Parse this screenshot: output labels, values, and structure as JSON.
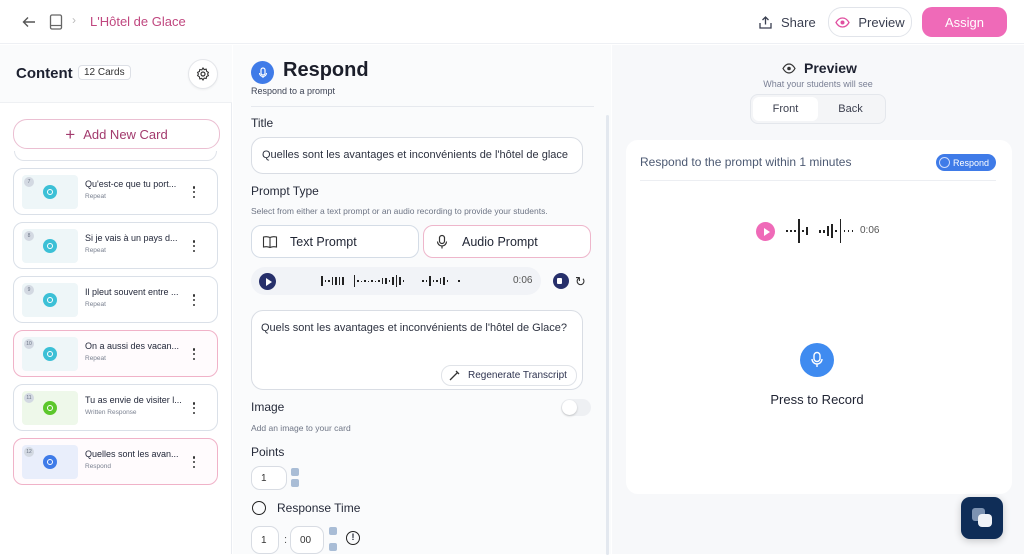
{
  "topbar": {
    "back_icon": "arrow-left-icon",
    "book_icon": "book-icon",
    "breadcrumb": "L'Hôtel de Glace",
    "share_label": "Share",
    "preview_label": "Preview",
    "assign_label": "Assign",
    "colors": {
      "accent": "#ef6ab8",
      "breadcrumb": "#c0477f"
    }
  },
  "content": {
    "title": "Content",
    "count": "12 Cards",
    "add_card_label": "Add New Card",
    "cards": [
      {
        "num": "7",
        "title": "Qu'est-ce que tu port...",
        "type": "Repeat",
        "color": "#3cc0d6",
        "bg": "#eef6f8",
        "selected": false
      },
      {
        "num": "8",
        "title": "Si je vais à un pays d...",
        "type": "Repeat",
        "color": "#3cc0d6",
        "bg": "#eef6f8",
        "selected": false
      },
      {
        "num": "9",
        "title": "Il pleut souvent entre ...",
        "type": "Repeat",
        "color": "#3cc0d6",
        "bg": "#eef6f8",
        "selected": false
      },
      {
        "num": "10",
        "title": "On a aussi des vacan...",
        "type": "Repeat",
        "color": "#3cc0d6",
        "bg": "#eef6f8",
        "selected": true
      },
      {
        "num": "11",
        "title": "Tu as envie de visiter l...",
        "type": "Written Response",
        "color": "#5cc72c",
        "bg": "#eef8ea",
        "selected": false
      },
      {
        "num": "12",
        "title": "Quelles sont les avan...",
        "type": "Respond",
        "color": "#3f7be8",
        "bg": "#e9eefb",
        "selected": true
      }
    ]
  },
  "editor": {
    "heading": "Respond",
    "subheading": "Respond to a prompt",
    "title_label": "Title",
    "title_value": "Quelles sont les avantages et inconvénients de l'hôtel de glace",
    "prompt_type_label": "Prompt Type",
    "prompt_type_hint": "Select from either a text prompt or an audio recording to provide your students.",
    "text_prompt_label": "Text Prompt",
    "audio_prompt_label": "Audio Prompt",
    "audio_duration": "0:06",
    "transcript": "Quels sont les avantages et inconvénients de l'hôtel de Glace?",
    "regenerate_label": "Regenerate Transcript",
    "image_label": "Image",
    "image_hint": "Add an image to your card",
    "image_enabled": false,
    "points_label": "Points",
    "points_value": "1",
    "response_time_label": "Response Time",
    "response_minutes": "1",
    "response_seconds": "00",
    "time_separator": ":"
  },
  "preview": {
    "title": "Preview",
    "subtitle": "What your students will see",
    "tabs": [
      "Front",
      "Back"
    ],
    "active_tab": "Front",
    "prompt_text": "Respond to the prompt within 1 minutes",
    "badge": "Respond",
    "audio_duration": "0:06",
    "record_label": "Press to Record"
  }
}
